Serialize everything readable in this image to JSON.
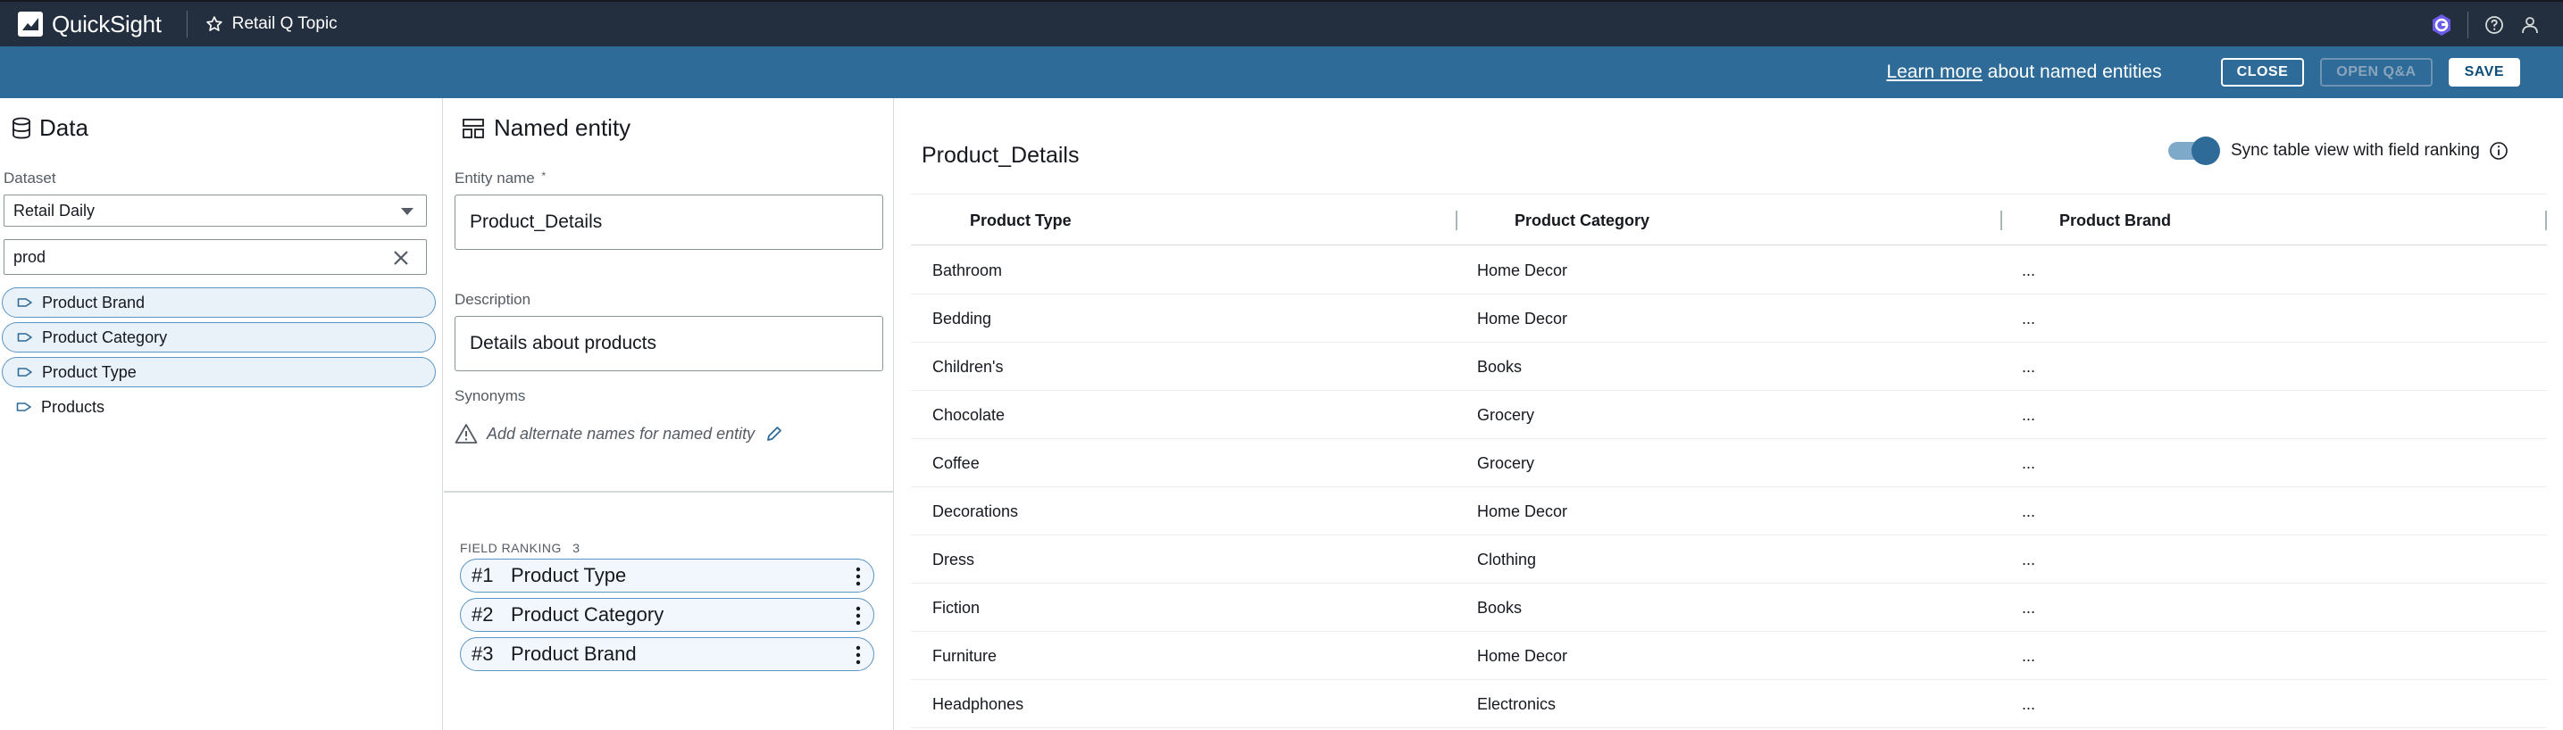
{
  "app": {
    "name": "QuickSight",
    "topic": "Retail Q Topic"
  },
  "bar": {
    "learn_link": "Learn more",
    "learn_rest": " about named entities",
    "close": "CLOSE",
    "open_qa": "OPEN Q&A",
    "save": "SAVE"
  },
  "data_panel": {
    "title": "Data",
    "dataset_label": "Dataset",
    "dataset_value": "Retail Daily",
    "search_value": "prod",
    "fields": [
      {
        "label": "Product Brand",
        "selected": true
      },
      {
        "label": "Product Category",
        "selected": true
      },
      {
        "label": "Product Type",
        "selected": true
      },
      {
        "label": "Products",
        "selected": false
      }
    ]
  },
  "entity_panel": {
    "title": "Named entity",
    "name_label": "Entity name",
    "name_required": "*",
    "name_value": "Product_Details",
    "description_label": "Description",
    "description_value": "Details about products",
    "synonyms_label": "Synonyms",
    "synonyms_placeholder": "Add alternate names for named entity",
    "ranking_label": "FIELD RANKING",
    "ranking_count": "3",
    "ranking": [
      {
        "num": "#1",
        "label": "Product Type"
      },
      {
        "num": "#2",
        "label": "Product Category"
      },
      {
        "num": "#3",
        "label": "Product Brand"
      }
    ]
  },
  "table_panel": {
    "title": "Product_Details",
    "sync_label": "Sync table view with field ranking",
    "sync_on": true,
    "columns": [
      "Product Type",
      "Product Category",
      "Product Brand"
    ],
    "rows": [
      [
        "Bathroom",
        "Home Decor",
        "..."
      ],
      [
        "Bedding",
        "Home Decor",
        "..."
      ],
      [
        "Children's",
        "Books",
        "..."
      ],
      [
        "Chocolate",
        "Grocery",
        "..."
      ],
      [
        "Coffee",
        "Grocery",
        "..."
      ],
      [
        "Decorations",
        "Home Decor",
        "..."
      ],
      [
        "Dress",
        "Clothing",
        "..."
      ],
      [
        "Fiction",
        "Books",
        "..."
      ],
      [
        "Furniture",
        "Home Decor",
        "..."
      ],
      [
        "Headphones",
        "Electronics",
        "..."
      ]
    ]
  },
  "colors": {
    "nav": "#232f3e",
    "bar": "#2e6b99",
    "accent": "#5b95c4"
  }
}
